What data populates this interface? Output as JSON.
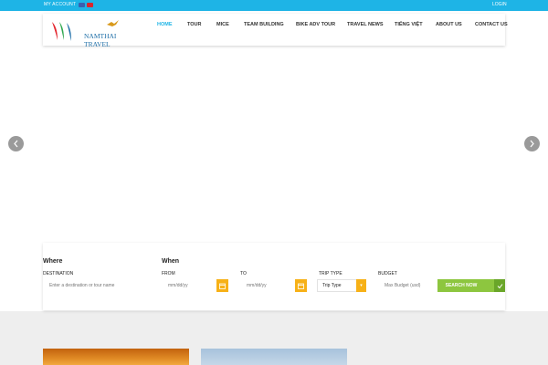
{
  "topbar": {
    "account_label": "MY ACCOUNT",
    "login_label": "LOGIN",
    "flags": [
      {
        "name": "english-flag-icon",
        "color": "#3b5fb0"
      },
      {
        "name": "vietnamese-flag-icon",
        "color": "#d8262e"
      }
    ]
  },
  "brand": {
    "logo_text": "NAMTHAI TRAVEL",
    "colors": {
      "red": "#e3262e",
      "green": "#2fa84f",
      "blue": "#1f6fa8",
      "gold": "#d99a1c"
    }
  },
  "nav": {
    "items": [
      {
        "label": "HOME",
        "active": true
      },
      {
        "label": "TOUR",
        "active": false
      },
      {
        "label": "MICE",
        "active": false
      },
      {
        "label": "TEAM BUILDING",
        "active": false
      },
      {
        "label": "BIKE ADV TOUR",
        "active": false
      },
      {
        "label": "TRAVEL NEWS",
        "active": false
      },
      {
        "label": "TIẾNG VIỆT",
        "active": false
      },
      {
        "label": "ABOUT US",
        "active": false
      },
      {
        "label": "CONTACT US",
        "active": false
      }
    ]
  },
  "slider": {
    "prev_icon": "chevron-left-icon",
    "next_icon": "chevron-right-icon"
  },
  "search": {
    "where_heading": "Where",
    "when_heading": "When",
    "destination_label": "DESTINATION",
    "destination_placeholder": "Enter a destination or tour name",
    "from_label": "FROM",
    "from_placeholder": "mm/dd/yy",
    "to_label": "TO",
    "to_placeholder": "mm/dd/yy",
    "trip_type_label": "TRIP TYPE",
    "trip_type_value": "Trip Type",
    "budget_label": "BUDGET",
    "budget_placeholder": "Max Budget (usd)",
    "submit_label": "SEARCH NOW"
  },
  "colors": {
    "topbar": "#1eb4e6",
    "accent_orange": "#f7b117",
    "submit_green": "#8dc63f"
  }
}
